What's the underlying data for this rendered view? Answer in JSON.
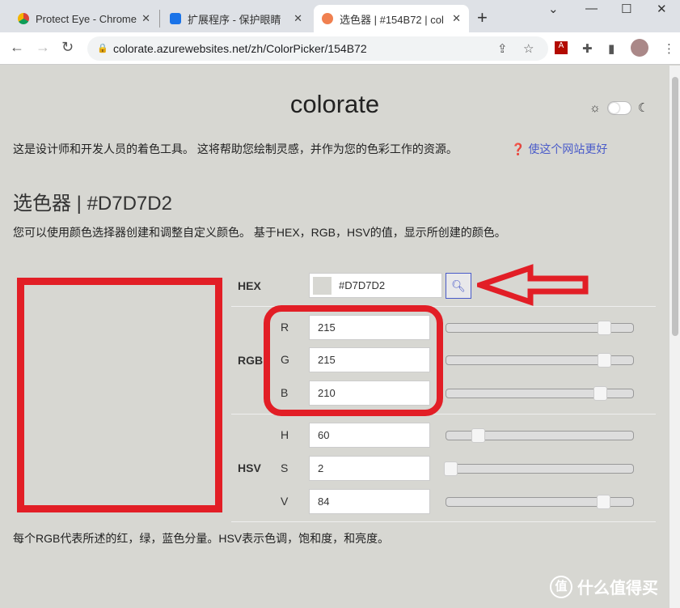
{
  "browser": {
    "tabs": [
      {
        "title": "Protect Eye - Chrome"
      },
      {
        "title": "扩展程序 - 保护眼睛"
      },
      {
        "title": "选色器 | #154B72 | col",
        "active": true
      }
    ],
    "url": "colorate.azurewebsites.net/zh/ColorPicker/154B72"
  },
  "site": {
    "title": "colorate",
    "intro": "这是设计师和开发人员的着色工具。 这将帮助您绘制灵感，并作为您的色彩工作的资源。",
    "help_link": "使这个网站更好",
    "heading": "选色器 | #D7D7D2",
    "description": "您可以使用颜色选择器创建和调整自定义颜色。 基于HEX，RGB，HSV的值，显示所创建的颜色。",
    "footer": "每个RGB代表所述的红，绿，蓝色分量。HSV表示色调，饱和度，和亮度。"
  },
  "picker": {
    "preview_color": "#D7D7D2",
    "hex_label": "HEX",
    "hex_value": "#D7D7D2",
    "rgb_label": "RGB",
    "hsv_label": "HSV",
    "rgb": [
      {
        "ch": "R",
        "value": "215",
        "max": 255
      },
      {
        "ch": "G",
        "value": "215",
        "max": 255
      },
      {
        "ch": "B",
        "value": "210",
        "max": 255
      }
    ],
    "hsv": [
      {
        "ch": "H",
        "value": "60",
        "max": 360
      },
      {
        "ch": "S",
        "value": "2",
        "max": 100
      },
      {
        "ch": "V",
        "value": "84",
        "max": 100
      }
    ]
  },
  "annotation_color": "#E21E26",
  "watermark": "值 什么值得买"
}
